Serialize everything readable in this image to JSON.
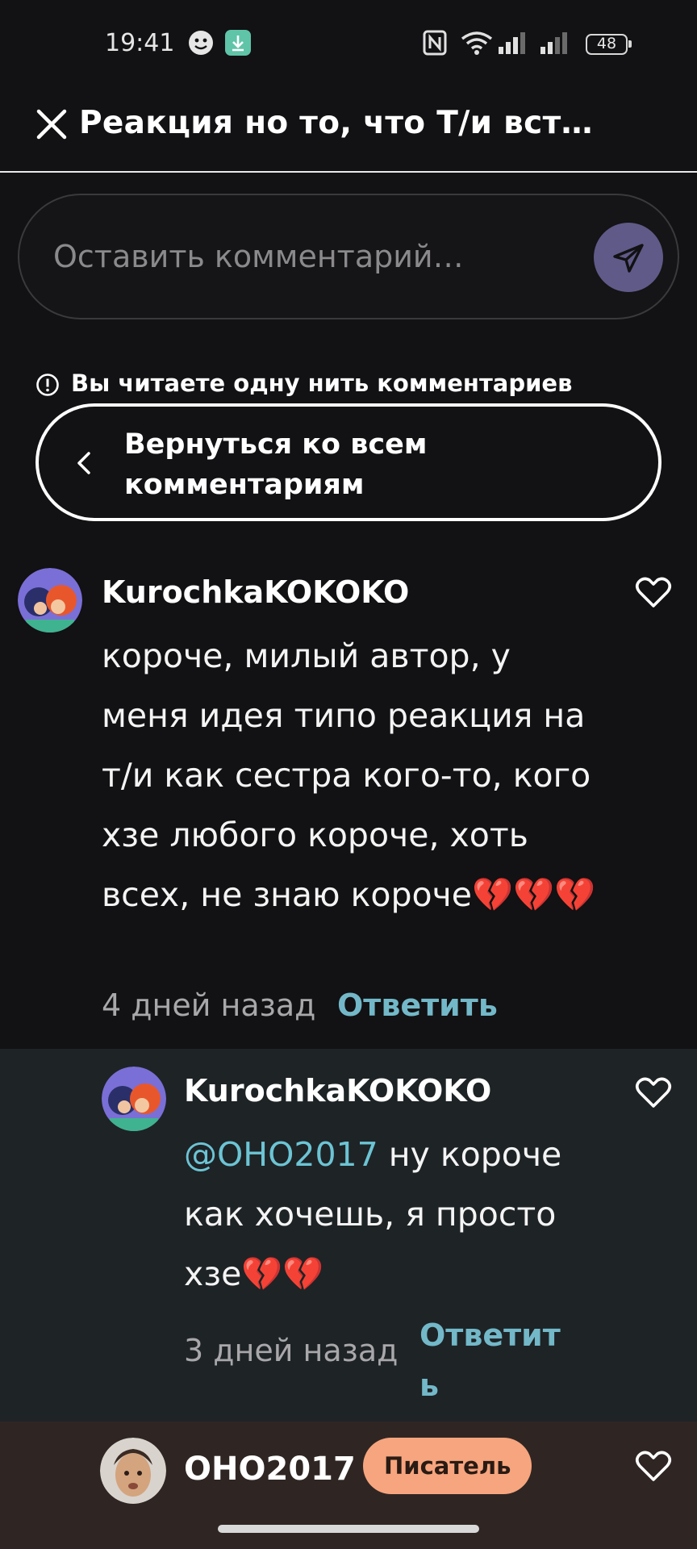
{
  "status_bar": {
    "time": "19:41",
    "battery": "48"
  },
  "header": {
    "title": "Реакция но то, что Т/и встр…"
  },
  "comment_input": {
    "placeholder": "Оставить комментарий…"
  },
  "thread": {
    "notice": "Вы читаете одну нить комментариев",
    "back_label": "Вернуться ко всем комментариям"
  },
  "comments": [
    {
      "username": "KurochkaKOKOKO",
      "text": "короче, милый автор, у меня идея типо реакция на т/и как сестра кого-то, кого хзе любого короче, хоть всех, не знаю короче💔💔💔",
      "time": "4 дней назад",
      "reply_label": "Ответить"
    },
    {
      "username": "KurochkaKOKOKO",
      "mention": "@OHO2017",
      "text": " ну короче как хочешь, я просто хзе💔💔",
      "time": "3 дней назад",
      "reply_label": "Ответить"
    },
    {
      "username": "OHO2017",
      "badge": "Писатель"
    }
  ],
  "colors": {
    "background": "#121113",
    "accent_send": "#5f5a88",
    "reply_link": "#73b8c8",
    "badge_bg": "#f7a57e"
  }
}
